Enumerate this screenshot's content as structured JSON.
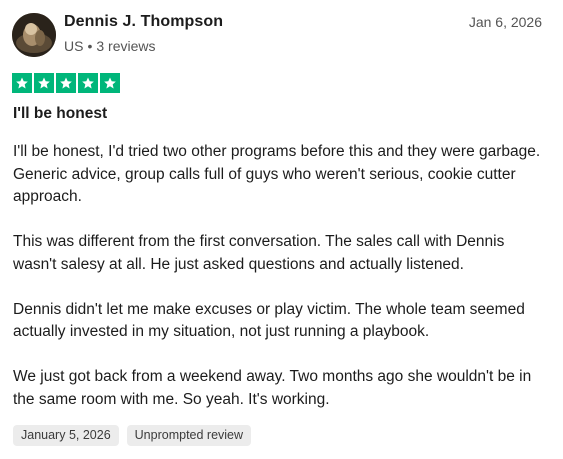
{
  "review": {
    "author": {
      "name": "Dennis J. Thompson",
      "country": "US",
      "separator": "•",
      "review_count": "3 reviews"
    },
    "date": "Jan 6, 2026",
    "rating": {
      "stars": 5,
      "out_of": 5,
      "star_color": "#00b67a"
    },
    "title": "I'll be honest",
    "paragraphs": [
      "I'll be honest, I'd tried two other programs before this and they were garbage. Generic advice, group calls full of guys who weren't serious, cookie cutter approach.",
      "This was different from the first conversation. The sales call with Dennis wasn't salesy at all. He just asked questions and actually listened.",
      "Dennis didn't let me make excuses or play victim. The whole team seemed actually invested in my situation, not just running a playbook.",
      "We just got back from a weekend away. Two months ago she wouldn't be in the same room with me. So yeah. It's working."
    ],
    "tags": {
      "experience_date": "January 5, 2026",
      "review_type": "Unprompted review"
    }
  }
}
